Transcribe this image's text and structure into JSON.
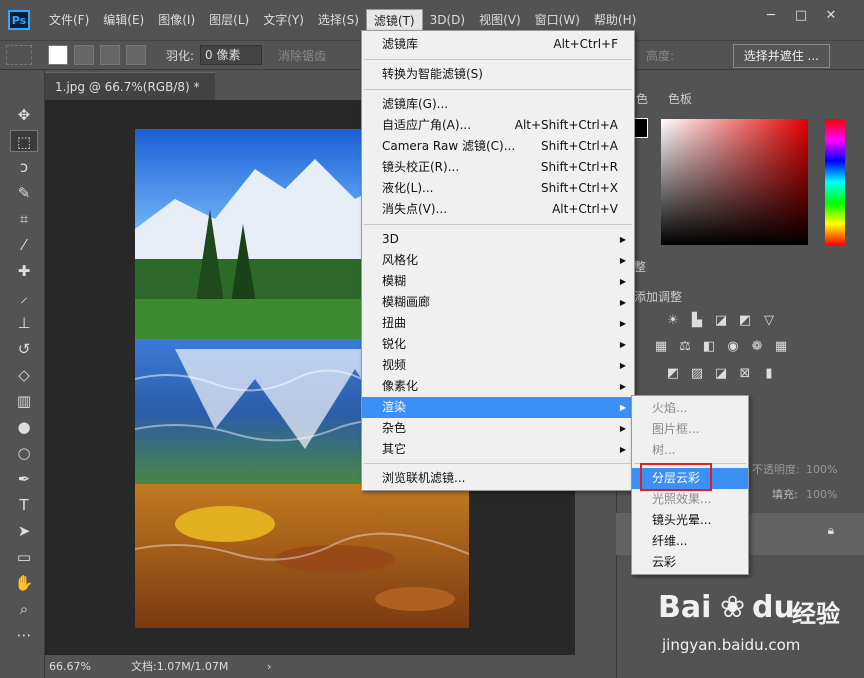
{
  "app": {
    "logo": "Ps"
  },
  "menubar": {
    "items": [
      "文件(F)",
      "编辑(E)",
      "图像(I)",
      "图层(L)",
      "文字(Y)",
      "选择(S)",
      "滤镜(T)",
      "3D(D)",
      "视图(V)",
      "窗口(W)",
      "帮助(H)"
    ],
    "active_index": 6,
    "window_controls": [
      "─",
      "□",
      "✕"
    ]
  },
  "options_bar": {
    "feather_label": "羽化:",
    "feather_value": "0 像素",
    "antialias_label": "消除锯齿",
    "height_label": "高度:",
    "select_mask_button": "选择并遮住 ..."
  },
  "document": {
    "tab_title": "1.jpg @ 66.7%(RGB/8) *",
    "tab_close": "×",
    "zoom": "66.67%",
    "doc_info": "文档:1.07M/1.07M",
    "status_arrow": "›"
  },
  "right_panel": {
    "color_tab": "色",
    "swatches_tab": "色板",
    "adjust_tab": "整",
    "add_adjustment": "添加调整",
    "opacity_label": "不透明度:",
    "opacity_value": "100%",
    "fill_label": "填充:",
    "fill_value": "100%"
  },
  "filter_menu": {
    "items": [
      {
        "label": "滤镜库",
        "shortcut": "Alt+Ctrl+F"
      },
      {
        "label": "转换为智能滤镜(S)",
        "shortcut": ""
      },
      {
        "label": "滤镜库(G)...",
        "shortcut": ""
      },
      {
        "label": "自适应广角(A)...",
        "shortcut": "Alt+Shift+Ctrl+A"
      },
      {
        "label": "Camera Raw 滤镜(C)...",
        "shortcut": "Shift+Ctrl+A"
      },
      {
        "label": "镜头校正(R)...",
        "shortcut": "Shift+Ctrl+R"
      },
      {
        "label": "液化(L)...",
        "shortcut": "Shift+Ctrl+X"
      },
      {
        "label": "消失点(V)...",
        "shortcut": "Alt+Ctrl+V"
      },
      {
        "label": "3D",
        "submenu": true
      },
      {
        "label": "风格化",
        "submenu": true
      },
      {
        "label": "模糊",
        "submenu": true
      },
      {
        "label": "模糊画廊",
        "submenu": true
      },
      {
        "label": "扭曲",
        "submenu": true
      },
      {
        "label": "锐化",
        "submenu": true
      },
      {
        "label": "视频",
        "submenu": true
      },
      {
        "label": "像素化",
        "submenu": true
      },
      {
        "label": "渲染",
        "submenu": true,
        "highlighted": true
      },
      {
        "label": "杂色",
        "submenu": true
      },
      {
        "label": "其它",
        "submenu": true
      },
      {
        "label": "浏览联机滤镜...",
        "shortcut": ""
      }
    ]
  },
  "render_submenu": {
    "items": [
      {
        "label": "火焰...",
        "disabled": true
      },
      {
        "label": "图片框...",
        "disabled": true
      },
      {
        "label": "树...",
        "disabled": true
      },
      {
        "label": "分层云彩",
        "highlighted": true
      },
      {
        "label": "光照效果...",
        "disabled": true
      },
      {
        "label": "镜头光晕..."
      },
      {
        "label": "纤维..."
      },
      {
        "label": "云彩"
      }
    ]
  },
  "watermark": {
    "brand": "Bai",
    "brand2": "du",
    "cn": "经验",
    "url": "jingyan.baidu.com"
  },
  "colors": {
    "highlight": "#3b8ff5",
    "callout": "#e02020",
    "canvas_bg": "#282828"
  }
}
